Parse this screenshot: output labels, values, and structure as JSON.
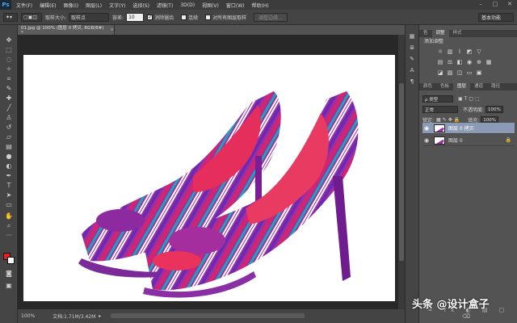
{
  "app": {
    "logo": "Ps"
  },
  "menu": [
    "文件(F)",
    "编辑(E)",
    "图像(I)",
    "图层(L)",
    "文字(Y)",
    "选择(S)",
    "滤镜(T)",
    "3D(D)",
    "视图(V)",
    "窗口(W)",
    "帮助(H)"
  ],
  "window_controls": [
    "–",
    "□",
    "✕"
  ],
  "options": {
    "sample_size_label": "取样大小:",
    "sample_size_value": "取样点",
    "tolerance_label": "容差:",
    "tolerance_value": "10",
    "antialias_label": "消除锯齿",
    "contiguous_label": "连续",
    "sample_all_label": "对所有图层取样",
    "refine_edge_label": "调整边缘...",
    "workspace": "基本功能"
  },
  "document": {
    "tab_title": "01.jpg @ 100% (图层 0 拷贝, RGB/8#) *",
    "close": "×"
  },
  "status": {
    "zoom": "100%",
    "doc_info": "文档:1.71M/3.42M"
  },
  "panels": {
    "top_tabs": [
      "色",
      "调整",
      "样式"
    ],
    "adjust_title": "添加调整",
    "layer_tabs": [
      "颜色",
      "色板",
      "图层",
      "通道",
      "路径"
    ],
    "filter_kind": "ρ 类型",
    "blend_mode": "正常",
    "opacity_label": "不透明度:",
    "opacity_value": "100%",
    "lock_label": "锁定:",
    "fill_label": "填充:",
    "fill_value": "100%",
    "layers": [
      {
        "name": "图层 0 拷贝",
        "selected": true
      },
      {
        "name": "图层 0",
        "selected": false
      }
    ]
  },
  "watermark": "头条 @设计盒子",
  "colors": {
    "foreground": "#e31e24",
    "background": "#ffffff",
    "layer_selected": "#8b9ab5"
  }
}
